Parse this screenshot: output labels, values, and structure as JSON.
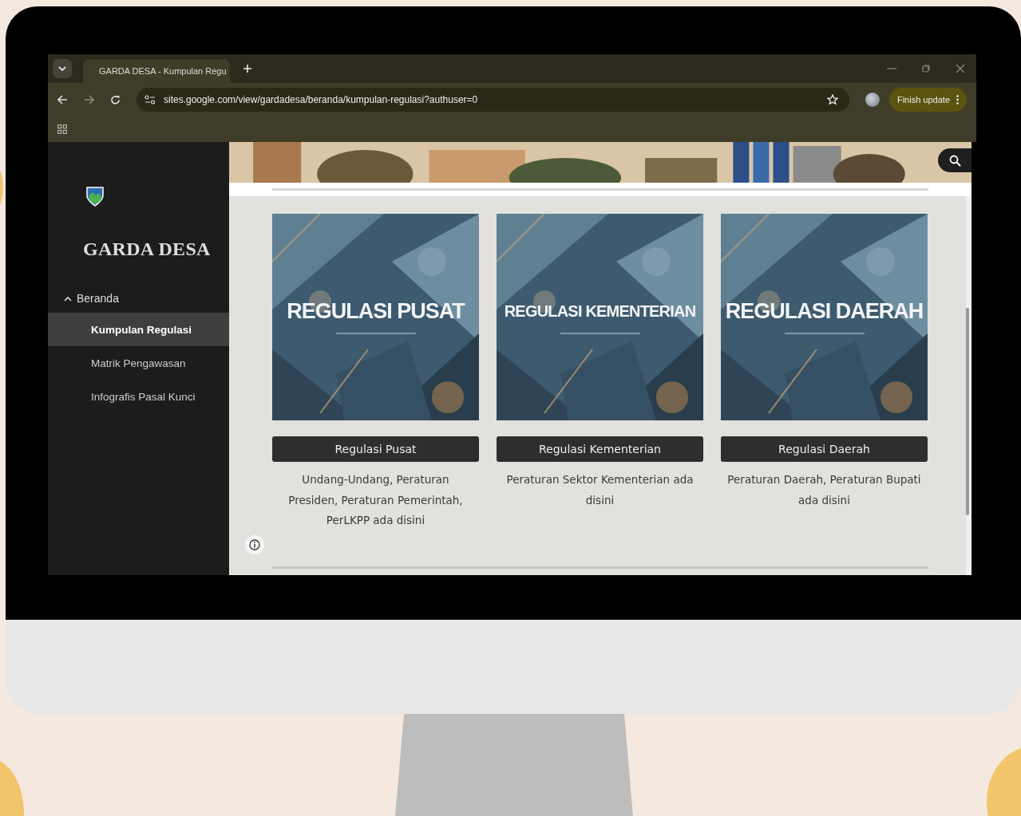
{
  "browser": {
    "tab": {
      "title": "GARDA DESA - Kumpulan Regu"
    },
    "address": "sites.google.com/view/gardadesa/beranda/kumpulan-regulasi?authuser=0",
    "update_button": "Finish update"
  },
  "sidebar": {
    "site_title": "GARDA DESA",
    "nav": [
      {
        "label": "Beranda",
        "expanded": true,
        "selected": false,
        "children": [
          {
            "label": "Kumpulan Regulasi",
            "selected": true
          },
          {
            "label": "Matrik Pengawasan",
            "selected": false
          },
          {
            "label": "Infografis Pasal Kunci",
            "selected": false
          }
        ]
      }
    ]
  },
  "cards": [
    {
      "image_title": "REGULASI PUSAT",
      "button": "Regulasi Pusat",
      "description": "Undang-Undang, Peraturan Presiden, Peraturan Pemerintah, PerLKPP ada disini"
    },
    {
      "image_title": "REGULASI KEMENTERIAN",
      "button": "Regulasi Kementerian",
      "description": "Peraturan Sektor Kementerian ada disini"
    },
    {
      "image_title": "REGULASI DAERAH",
      "button": "Regulasi Daerah",
      "description": "Peraturan Daerah, Peraturan Bupati ada disini"
    }
  ]
}
